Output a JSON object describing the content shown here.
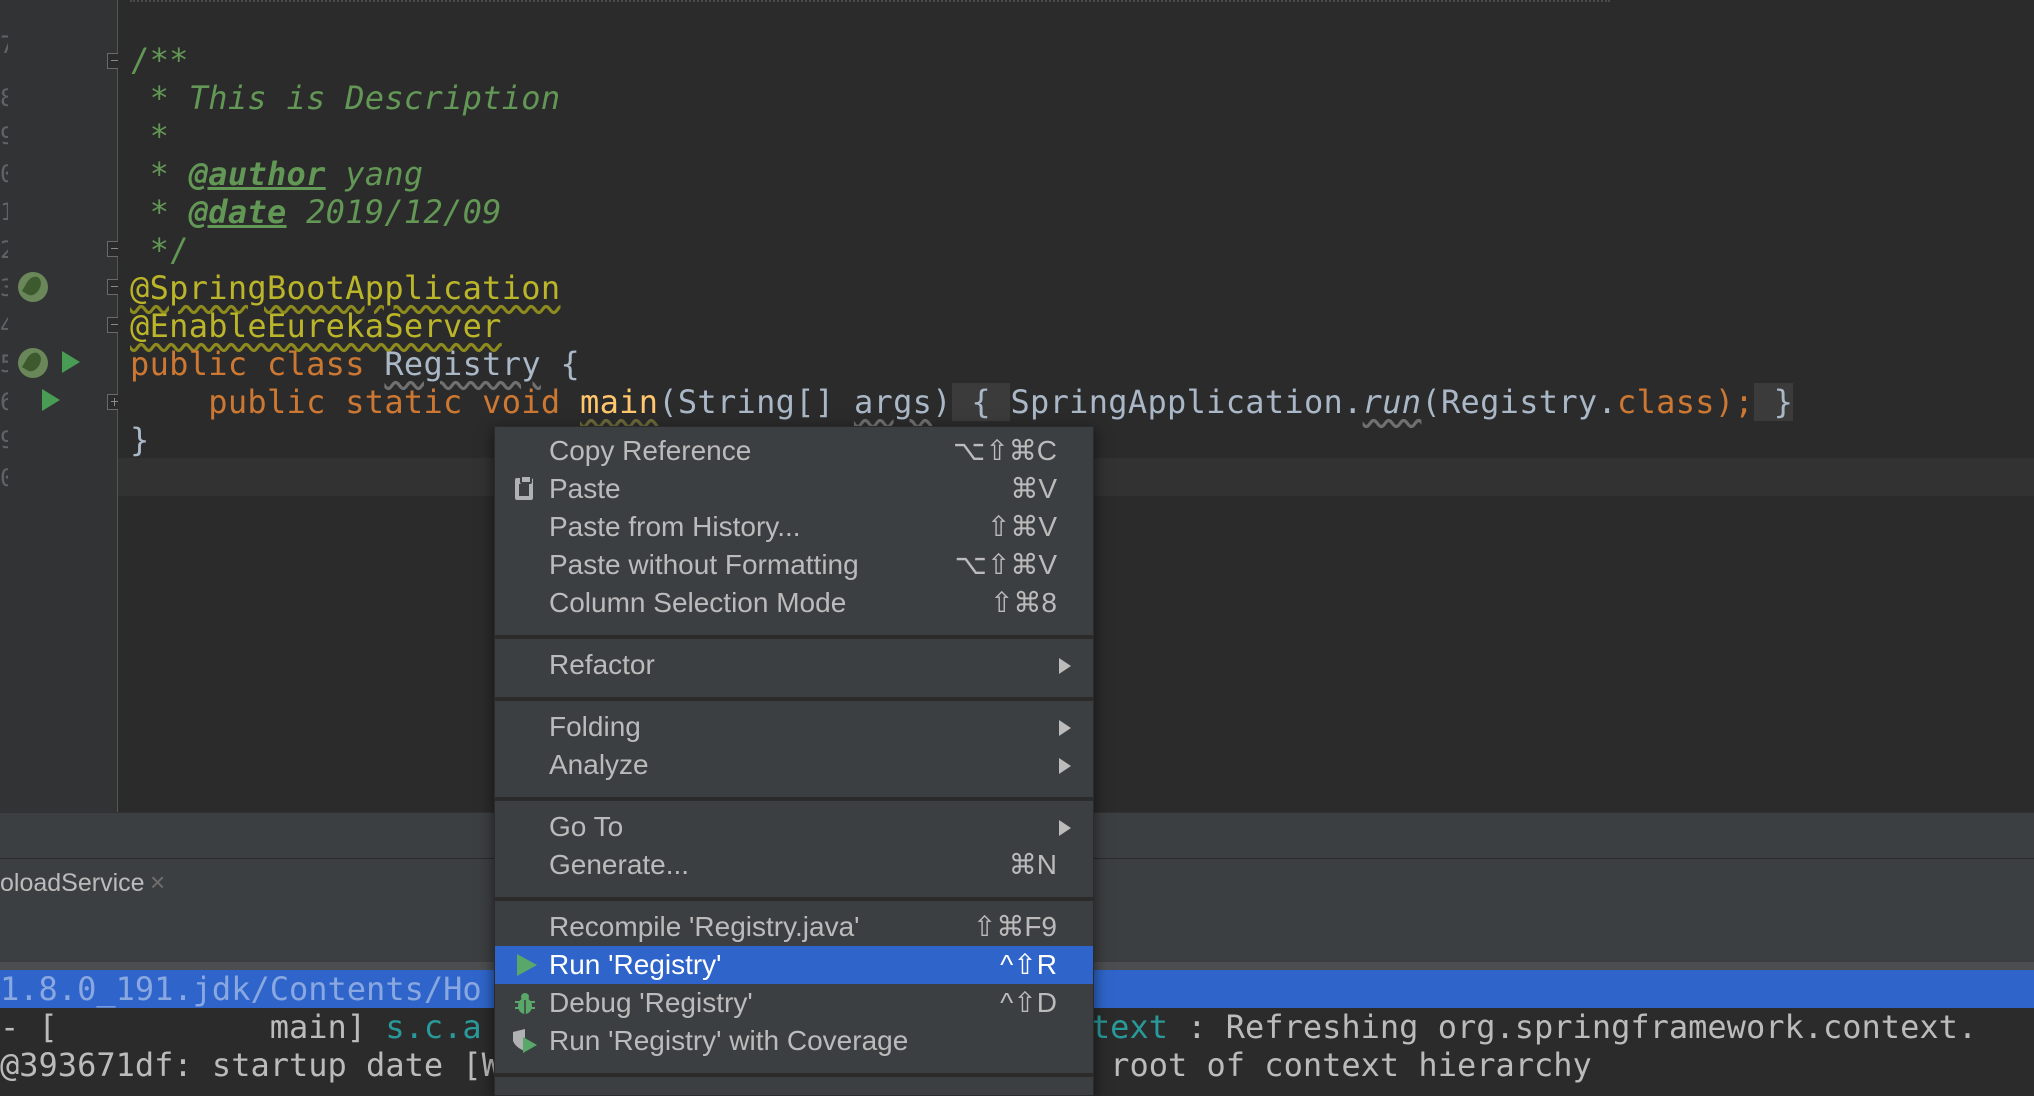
{
  "editor": {
    "line_numbers": [
      "7",
      "8",
      "9",
      "0",
      "1",
      "2",
      "3",
      "4",
      "5",
      "6",
      "9",
      "0"
    ],
    "code": {
      "javadoc_open": "/**",
      "desc_line": " * This is Description",
      "blank_line": " *",
      "author_prefix": " * ",
      "author_tag": "@author",
      "author_value": " yang",
      "date_prefix": " * ",
      "date_tag": "@date",
      "date_value": " 2019/12/09",
      "javadoc_close": " */",
      "annotation1": "@SpringBootApplication",
      "annotation2": "@EnableEurekaServer",
      "class_kw": "public class ",
      "class_name": "Registry",
      "class_open": " {",
      "main_kw": "    public static void ",
      "main_name": "main",
      "main_params_open": "(String[] ",
      "main_args": "args",
      "main_params_close": ")",
      "fold_open": " { ",
      "body_start": "SpringApplication.",
      "body_run": "run",
      "body_paren": "(Registry.",
      "body_class_kw": "class",
      "body_end": ");",
      "fold_close": " }",
      "class_close": "}"
    }
  },
  "tool_window": {
    "tab_label": "oloadService",
    "tab_close": "×",
    "console_lines": {
      "line1": "1.8.0_191.jdk/Contents/Ho",
      "line2_a": "- [           main] ",
      "line2_b": "s.c.a",
      "line2_c": "ntext",
      "line2_d": " : Refreshing org.springframework.context.",
      "line3_a": "@393671df: startup date [W",
      "line3_b": " root of context hierarchy"
    }
  },
  "context_menu": {
    "items": [
      {
        "label": "Copy Reference",
        "shortcut": "⌥⇧⌘C"
      },
      {
        "label": "Paste",
        "shortcut": "⌘V"
      },
      {
        "label": "Paste from History...",
        "shortcut": "⇧⌘V"
      },
      {
        "label": "Paste without Formatting",
        "shortcut": "⌥⇧⌘V"
      },
      {
        "label": "Column Selection Mode",
        "shortcut": "⇧⌘8"
      },
      {
        "label": "Refactor",
        "shortcut": ""
      },
      {
        "label": "Folding",
        "shortcut": ""
      },
      {
        "label": "Analyze",
        "shortcut": ""
      },
      {
        "label": "Go To",
        "shortcut": ""
      },
      {
        "label": "Generate...",
        "shortcut": "⌘N"
      },
      {
        "label": "Recompile 'Registry.java'",
        "shortcut": "⇧⌘F9"
      },
      {
        "label": "Run 'Registry'",
        "shortcut": "^⇧R"
      },
      {
        "label": "Debug 'Registry'",
        "shortcut": "^⇧D"
      },
      {
        "label": "Run 'Registry' with Coverage",
        "shortcut": ""
      }
    ],
    "selected_item": "Run 'Registry'"
  },
  "colors": {
    "editor_bg": "#2b2b2b",
    "gutter_bg": "#313335",
    "menu_bg": "#3c3f41",
    "selection": "#2f65ca",
    "keyword": "#cc7832",
    "annotation": "#bbb529",
    "comment": "#629755",
    "method": "#ffc66d",
    "run_green": "#59a869"
  },
  "icons": [
    "spring-bean-icon",
    "run-gutter-icon",
    "fold-marker-icon",
    "paste-icon",
    "run-icon",
    "debug-icon",
    "coverage-icon",
    "submenu-arrow-icon",
    "close-icon"
  ]
}
